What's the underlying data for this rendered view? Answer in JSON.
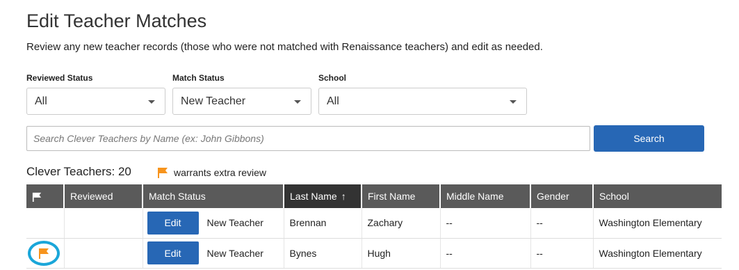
{
  "page": {
    "title": "Edit Teacher Matches",
    "subtitle": "Review any new teacher records (those who were not matched with Renaissance teachers) and edit as needed."
  },
  "filters": {
    "reviewed": {
      "label": "Reviewed Status",
      "value": "All"
    },
    "match": {
      "label": "Match Status",
      "value": "New Teacher"
    },
    "school": {
      "label": "School",
      "value": "All"
    }
  },
  "search": {
    "placeholder": "Search Clever Teachers by Name (ex: John Gibbons)",
    "button_label": "Search"
  },
  "summary": {
    "count_label": "Clever Teachers: 20",
    "legend_label": "warrants extra review"
  },
  "table": {
    "headers": {
      "reviewed": "Reviewed",
      "match_status": "Match Status",
      "last_name": "Last Name",
      "first_name": "First Name",
      "middle_name": "Middle Name",
      "gender": "Gender",
      "school": "School"
    },
    "sort_arrow": "↑",
    "edit_label": "Edit",
    "rows": [
      {
        "flagged": false,
        "match_status": "New Teacher",
        "last_name": "Brennan",
        "first_name": "Zachary",
        "middle_name": "--",
        "gender": "--",
        "school": "Washington Elementary"
      },
      {
        "flagged": true,
        "match_status": "New Teacher",
        "last_name": "Bynes",
        "first_name": "Hugh",
        "middle_name": "--",
        "gender": "--",
        "school": "Washington Elementary"
      }
    ]
  },
  "colors": {
    "primary_button": "#2767b5",
    "flag": "#f7941d",
    "highlight_circle": "#1aa6d9",
    "header_bg": "#5a5a5a"
  }
}
